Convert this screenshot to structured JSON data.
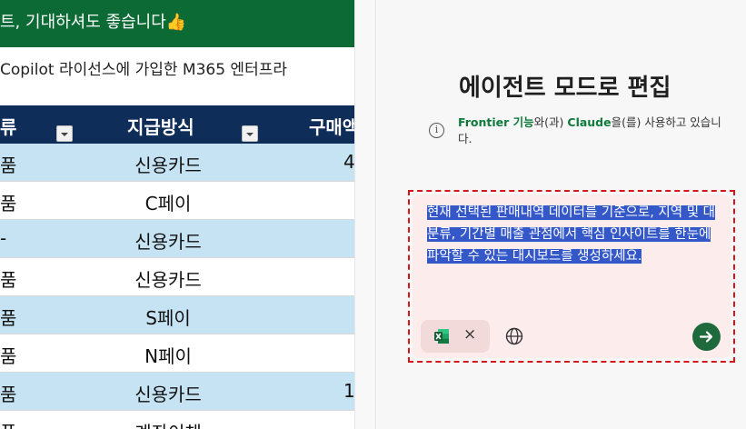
{
  "sheet": {
    "banner_text": "트, 기대하셔도 좋습니다👍",
    "subline": "Copilot 라이선스에 가입한 M365 엔터프라",
    "headers": {
      "category": "류",
      "payment": "지급방식",
      "amount": "구매액"
    },
    "rows": [
      {
        "category": "품",
        "payment": "신용카드",
        "amount": "4"
      },
      {
        "category": "품",
        "payment": "C페이",
        "amount": ""
      },
      {
        "category": "-",
        "payment": "신용카드",
        "amount": ""
      },
      {
        "category": "품",
        "payment": "신용카드",
        "amount": ""
      },
      {
        "category": "품",
        "payment": "S페이",
        "amount": ""
      },
      {
        "category": "품",
        "payment": "N페이",
        "amount": ""
      },
      {
        "category": "품",
        "payment": "신용카드",
        "amount": "1"
      },
      {
        "category": "품",
        "payment": "계좌이체",
        "amount": ""
      }
    ],
    "colors": {
      "banner": "#0c6b35",
      "header": "#0f2d59",
      "row_blue": "#c5e3f3"
    }
  },
  "panel": {
    "title": "에이전트 모드로 편집",
    "info": {
      "frontier": "Frontier 기능",
      "mid1": "와(과) ",
      "claude": "Claude",
      "rest": "을(를) 사용하고 있습니다."
    },
    "prompt": "현재 선택된 판매내역 데이터를 기준으로, 지역 및 대분류, 기간별 매출 관점에서 핵심 인사이트를 한눈에 파악할 수 있는 대시보드를 생성하세요.",
    "chip_close": "×",
    "icons": {
      "info": "info-icon",
      "excel": "excel-icon",
      "globe": "globe-icon",
      "send": "send-arrow-icon"
    },
    "colors": {
      "accent": "#1f6a3c",
      "selection": "#3558c9",
      "dash": "#d8141b"
    }
  }
}
